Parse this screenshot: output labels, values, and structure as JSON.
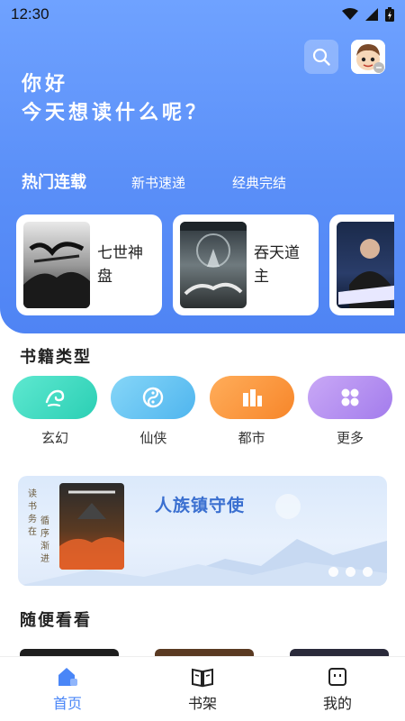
{
  "status_bar": {
    "time": "12:30"
  },
  "header": {
    "greeting_line1": "你好",
    "greeting_line2": "今天想读什么呢？",
    "tabs": [
      {
        "label": "热门连载",
        "active": true
      },
      {
        "label": "新书速递",
        "active": false
      },
      {
        "label": "经典完结",
        "active": false
      }
    ]
  },
  "hot_books": [
    {
      "title_line1": "七世神",
      "title_line2": "盘"
    },
    {
      "title_line1": "吞天道",
      "title_line2": "主"
    },
    {
      "title_line1": "",
      "title_line2": ""
    }
  ],
  "categories_section": {
    "title": "书籍类型",
    "items": [
      {
        "label": "玄幻",
        "color": "#3dd9c1"
      },
      {
        "label": "仙侠",
        "color": "#63c3f0"
      },
      {
        "label": "都市",
        "color": "#f8963b"
      },
      {
        "label": "更多",
        "color": "#b48ff0"
      }
    ]
  },
  "banner": {
    "title": "人族镇守使",
    "vertical_texts": [
      "读书务在",
      "循序渐进"
    ]
  },
  "recommend_section": {
    "title": "随便看看"
  },
  "bottom_nav": [
    {
      "label": "首页",
      "icon": "home-icon",
      "active": true
    },
    {
      "label": "书架",
      "icon": "book-icon",
      "active": false
    },
    {
      "label": "我的",
      "icon": "profile-icon",
      "active": false
    }
  ],
  "colors": {
    "accent": "#4a86f7",
    "hero_top": "#6fa2ff",
    "hero_bottom": "#4f84f4"
  }
}
